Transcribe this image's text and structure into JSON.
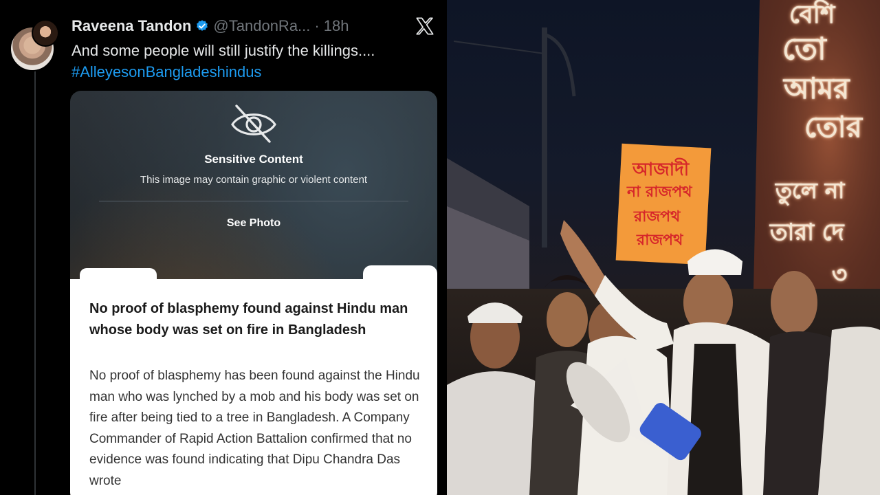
{
  "tweet": {
    "display_name": "Raveena Tandon",
    "handle": "@TandonRa...",
    "separator": "·",
    "time": "18h",
    "text": "And some people will still justify the killings....",
    "hashtag": "#AlleyesonBangladeshindus",
    "more_menu": "···",
    "verified_color": "#1d9bf0",
    "platform_icon": "x-logo-icon"
  },
  "sensitive_overlay": {
    "icon": "eye-slash-icon",
    "title": "Sensitive Content",
    "subtitle": "This image may contain graphic or violent content",
    "action_label": "See Photo"
  },
  "news_card": {
    "headline": "No proof of blasphemy found against Hindu man whose body was set on fire in Bangladesh",
    "body": "No proof of blasphemy has been found against the Hindu man who was lynched by a mob and his body was set on fire after being tied to a tree in Bangladesh. A Company Commander of Rapid Action Battalion confirmed that no evidence was found indicating that Dipu Chandra Das wrote"
  },
  "protest_photo": {
    "placard_lines": [
      "আজাদী",
      "না রাজপথ",
      "রাজপথ",
      "রাজপথ"
    ],
    "wall_lines": [
      "বেশি",
      "তো",
      "আমর",
      "তোর",
      "তুলে না",
      "তারা দে",
      "৩"
    ]
  }
}
